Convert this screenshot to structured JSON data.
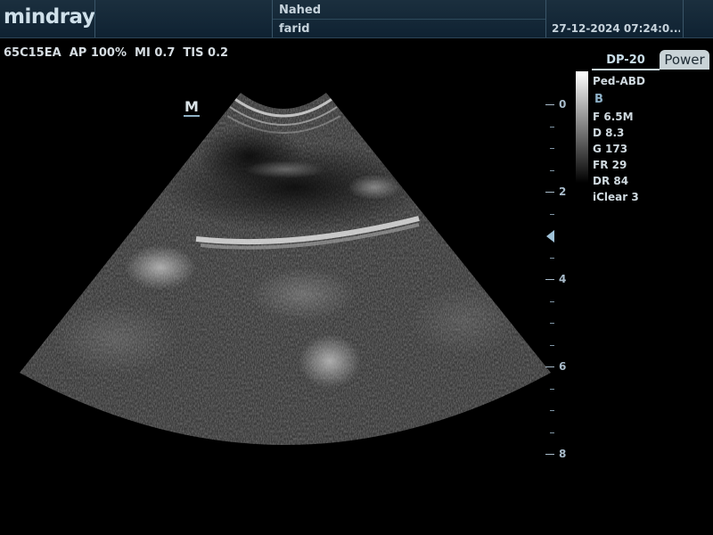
{
  "header": {
    "logo": "mindray",
    "patient_name_line1": "Nahed",
    "patient_name_line2": "farid",
    "datetime": "27-12-2024 07:24:0..."
  },
  "info": {
    "line": "65C15EA  AP 100%  MI 0.7  TIS 0.2"
  },
  "image": {
    "orientation_marker": "M"
  },
  "depth_scale": {
    "labels": [
      "0",
      "2",
      "4",
      "6",
      "8"
    ],
    "unit": "cm"
  },
  "panel": {
    "tab_dp": "DP-20",
    "tab_power": "Power",
    "preset": "Ped-ABD",
    "mode": "B",
    "params": [
      "F 6.5M",
      "D 8.3",
      "G 173",
      "FR 29",
      "DR 84",
      "iClear 3"
    ]
  },
  "colors": {
    "topbar": "#13283a",
    "accent": "#8fb2c9",
    "background": "#000000"
  }
}
